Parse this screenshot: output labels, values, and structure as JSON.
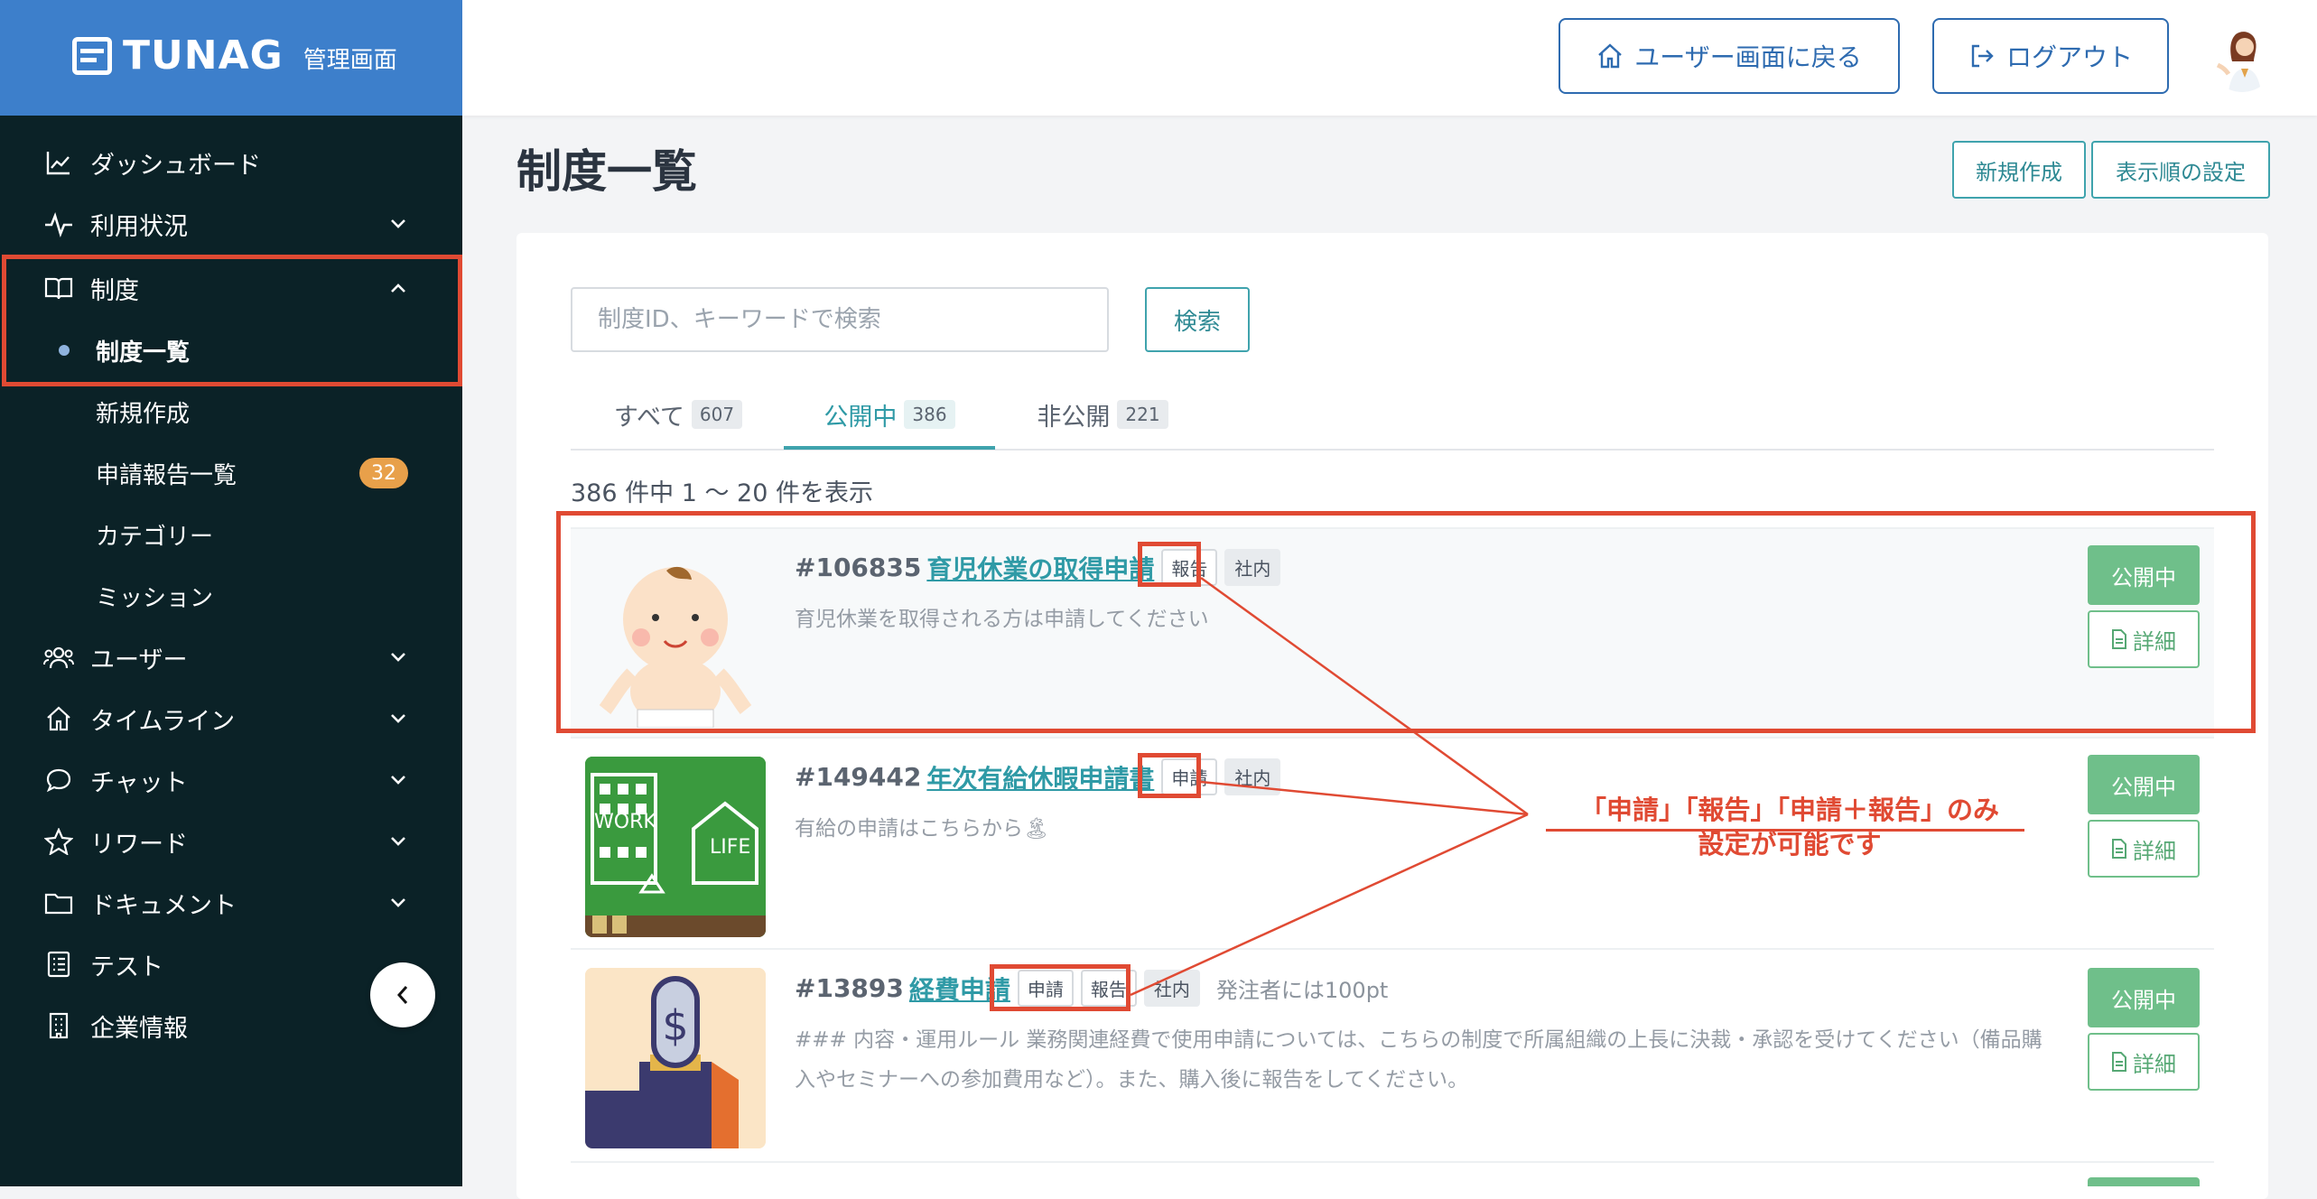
{
  "brand": {
    "logo_text": "TUNAG",
    "subtitle": "管理画面"
  },
  "sidebar": {
    "items": [
      {
        "label": "ダッシュボード",
        "icon": "chart-line-icon"
      },
      {
        "label": "利用状況",
        "icon": "activity-icon"
      },
      {
        "label": "制度",
        "icon": "book-icon",
        "expanded": true
      },
      {
        "label": "ユーザー",
        "icon": "users-icon"
      },
      {
        "label": "タイムライン",
        "icon": "home-icon"
      },
      {
        "label": "チャット",
        "icon": "chat-icon"
      },
      {
        "label": "リワード",
        "icon": "star-icon"
      },
      {
        "label": "ドキュメント",
        "icon": "folder-icon"
      },
      {
        "label": "テスト",
        "icon": "checklist-icon"
      },
      {
        "label": "企業情報",
        "icon": "building-icon"
      }
    ],
    "subitems": [
      {
        "label": "制度一覧",
        "active": true
      },
      {
        "label": "新規作成"
      },
      {
        "label": "申請報告一覧",
        "badge": "32"
      },
      {
        "label": "カテゴリー"
      },
      {
        "label": "ミッション"
      }
    ]
  },
  "header": {
    "back_label": "ユーザー画面に戻る",
    "logout_label": "ログアウト"
  },
  "page": {
    "title": "制度一覧",
    "new_label": "新規作成",
    "order_label": "表示順の設定"
  },
  "search": {
    "placeholder": "制度ID、キーワードで検索",
    "button": "検索"
  },
  "tabs": [
    {
      "label": "すべて",
      "count": "607"
    },
    {
      "label": "公開中",
      "count": "386",
      "active": true
    },
    {
      "label": "非公開",
      "count": "221"
    }
  ],
  "result_count": "386 件中 1 〜 20 件を表示",
  "rows": [
    {
      "id": "#106835",
      "name": "育児休業の取得申請",
      "tags": [
        "報告",
        "社内"
      ],
      "extra": "",
      "desc": "育児休業を取得される方は申請してください",
      "status": "公開中",
      "detail": "詳細"
    },
    {
      "id": "#149442",
      "name": "年次有給休暇申請書",
      "tags": [
        "申請",
        "社内"
      ],
      "extra": "",
      "desc": "有給の申請はこちらから🏝",
      "status": "公開中",
      "detail": "詳細",
      "thumb_text": [
        "WORK",
        "LIFE"
      ]
    },
    {
      "id": "#13893",
      "name": "経費申請",
      "tags": [
        "申請",
        "報告",
        "社内"
      ],
      "extra": "発注者には100pt",
      "desc": "### 内容・運用ルール 業務関連経費で使用申請については、こちらの制度で所属組織の上長に決裁・承認を受けてください（備品購入やセミナーへの参加費用など）。また、購入後に報告をしてください。",
      "status": "公開中",
      "detail": "詳細"
    }
  ],
  "annotation": {
    "line1": "「申請」「報告」「申請＋報告」のみ",
    "line2": "設定が可能です"
  },
  "colors": {
    "brand_blue": "#3d7fcb",
    "sidebar_bg": "#0b2227",
    "accent_teal": "#3fa3ad",
    "status_green": "#6fbf8a",
    "annotation_red": "#e04a33"
  }
}
